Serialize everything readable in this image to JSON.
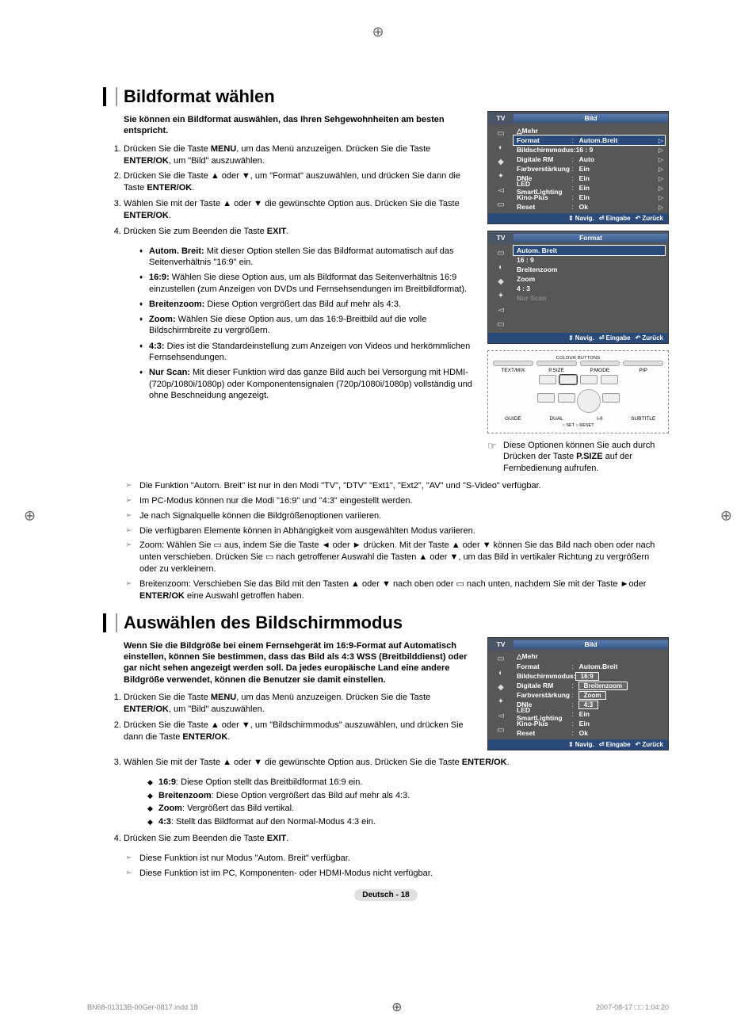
{
  "registration_mark": "⊕",
  "footer": {
    "left": "BN68-01313B-00Ger-0817.indd   18",
    "right": "2007-08-17   □□ 1:04:20"
  },
  "page_number": "Deutsch - 18",
  "section1": {
    "title": "Bildformat wählen",
    "intro": "Sie können ein Bildformat auswählen, das Ihren Sehgewohnheiten am besten entspricht.",
    "steps": [
      "Drücken Sie die Taste <b>MENU</b>, um das Menü anzuzeigen. Drücken Sie die Taste <b>ENTER/OK</b>, um \"Bild\" auszuwählen.",
      "Drücken Sie die Taste ▲ oder ▼, um \"Format\" auszuwählen, und drücken Sie dann die Taste <b>ENTER/OK</b>.",
      "Wählen Sie mit der Taste ▲ oder ▼ die gewünschte Option aus. Drücken Sie die Taste <b>ENTER/OK</b>.",
      "Drücken Sie zum Beenden die Taste <b>EXIT</b>."
    ],
    "bullets": [
      {
        "term": "Autom. Breit:",
        "desc": " Mit dieser Option stellen Sie das Bildformat automatisch auf das Seitenverhältnis \"16:9\" ein."
      },
      {
        "term": "16:9:",
        "desc": " Wählen Sie diese Option aus, um als Bildformat das Seitenverhältnis 16:9 einzustellen (zum Anzeigen von DVDs und Fernsehsendungen im Breitbildformat)."
      },
      {
        "term": "Breitenzoom:",
        "desc": " Diese Option vergrößert das Bild auf mehr als 4:3."
      },
      {
        "term": "Zoom:",
        "desc": " Wählen Sie diese Option aus, um das 16:9-Breitbild auf die volle Bildschirmbreite zu vergrößern."
      },
      {
        "term": "4:3:",
        "desc": " Dies ist die Standardeinstellung zum Anzeigen von Videos und herkömmlichen Fernsehsendungen."
      },
      {
        "term": "Nur Scan:",
        "desc": " Mit dieser Funktion wird das ganze Bild auch bei Versorgung mit HDMI- (720p/1080i/1080p) oder Komponentensignalen (720p/1080i/1080p) vollständig und ohne Beschneidung angezeigt."
      }
    ],
    "notes": [
      "Die Funktion \"Autom. Breit\" ist nur in den Modi \"TV\", \"DTV\" \"Ext1\", \"Ext2\", \"AV\" und \"S-Video\" verfügbar.",
      "Im PC-Modus können nur die Modi \"16:9\" und \"4:3\" eingestellt werden.",
      "Je nach Signalquelle können die Bildgrößenoptionen variieren.",
      "Die verfügbaren Elemente können in Abhängigkeit vom ausgewählten Modus variieren.",
      "Zoom: Wählen Sie ▭ aus, indem Sie die Taste ◄ oder ► drücken. Mit der Taste ▲ oder ▼ können Sie das Bild nach oben oder nach unten verschieben. Drücken Sie ▭ nach getroffener Auswahl die Tasten ▲ oder ▼, um das Bild in vertikaler Richtung zu vergrößern oder zu verkleinern.",
      "Breitenzoom: Verschieben Sie das Bild mit den Tasten ▲ oder ▼ nach oben oder ▭ nach unten, nachdem Sie mit der Taste ►oder <b>ENTER/OK</b> eine Auswahl getroffen haben."
    ],
    "hand_note": "Diese Optionen können Sie auch durch Drücken der Taste <b>P.SIZE</b> auf der Fernbedienung aufrufen.",
    "osd1": {
      "tv": "TV",
      "title": "Bild",
      "more": "△Mehr",
      "items": [
        {
          "label": "Format",
          "val": "Autom.Breit",
          "hi": true
        },
        {
          "label": "Bildschirmmodus:",
          "val": "16 : 9"
        },
        {
          "label": "Digitale RM",
          "val": "Auto"
        },
        {
          "label": "Farbverstärkung",
          "val": "Ein"
        },
        {
          "label": "DNIe",
          "val": "Ein"
        },
        {
          "label": "LED SmartLighting",
          "val": "Ein"
        },
        {
          "label": "Kino-Plus",
          "val": "Ein"
        },
        {
          "label": "Reset",
          "val": "Ok"
        }
      ],
      "footer": {
        "nav": "Navig.",
        "enter": "Eingabe",
        "back": "Zurück"
      }
    },
    "osd2": {
      "tv": "TV",
      "title": "Format",
      "items": [
        {
          "label": "Autom. Breit",
          "hi": true
        },
        {
          "label": "16 : 9"
        },
        {
          "label": "Breitenzoom"
        },
        {
          "label": "Zoom"
        },
        {
          "label": "4 : 3"
        },
        {
          "label": "Nur Scan",
          "dim": true
        }
      ],
      "footer": {
        "nav": "Navig.",
        "enter": "Eingabe",
        "back": "Zurück"
      }
    },
    "remote": {
      "row1": [
        "TEXT/MIX",
        "P.SIZE",
        "P.MODE",
        "PIP"
      ],
      "row2": [
        "GUIDE",
        "DUAL",
        "I-II",
        "SUBTITLE"
      ],
      "top_label": "COLOUR BUTTONS",
      "bottom": "○ SET    ○ RESET"
    }
  },
  "section2": {
    "title": "Auswählen des Bildschirmmodus",
    "intro": "Wenn Sie die Bildgröße bei einem Fernsehgerät im 16:9-Format auf Automatisch einstellen, können Sie bestimmen, dass das Bild als 4:3 WSS (Breitbilddienst) oder gar nicht sehen angezeigt werden soll. Da jedes europäische Land eine andere Bildgröße verwendet, können die Benutzer sie damit einstellen.",
    "steps": [
      "Drücken Sie die Taste <b>MENU</b>, um das Menü anzuzeigen. Drücken Sie die Taste <b>ENTER/OK</b>, um \"Bild\" auszuwählen.",
      "Drücken Sie die Taste ▲ oder ▼, um \"Bildschirmmodus\" auszuwählen, und drücken Sie dann die Taste <b>ENTER/OK</b>.",
      "Wählen Sie mit der Taste ▲ oder ▼ die gewünschte Option aus. Drücken Sie die Taste <b>ENTER/OK</b>."
    ],
    "diamonds": [
      "<b>16:9</b>: Diese Option stellt das Breitbildformat 16:9 ein.",
      "<b>Breitenzoom</b>: Diese Option vergrößert das Bild auf mehr als 4:3.",
      "<b>Zoom</b>: Vergrößert das Bild vertikal.",
      "<b>4:3</b>: Stellt das Bildformat auf den Normal-Modus 4:3 ein."
    ],
    "step4": "Drücken Sie zum Beenden die Taste <b>EXIT</b>.",
    "notes": [
      "Diese Funktion ist nur Modus \"Autom. Breit\" verfügbar.",
      "Diese Funktion ist im PC, Komponenten- oder HDMI-Modus nicht verfügbar."
    ],
    "osd": {
      "tv": "TV",
      "title": "Bild",
      "more": "△Mehr",
      "items": [
        {
          "label": "Format",
          "val": "Autom.Breit"
        },
        {
          "label": "Bildschirmmodus:",
          "val": "16:9",
          "drop": true,
          "hi": true
        },
        {
          "label": "Digitale RM",
          "val": "Breitenzoom",
          "drop": true
        },
        {
          "label": "Farbverstärkung",
          "val": "Zoom",
          "drop": true
        },
        {
          "label": "DNIe",
          "val": "4:3",
          "drop": true
        },
        {
          "label": "LED SmartLighting",
          "val": "Ein"
        },
        {
          "label": "Kino-Plus",
          "val": "Ein"
        },
        {
          "label": "Reset",
          "val": "Ok"
        }
      ],
      "footer": {
        "nav": "Navig.",
        "enter": "Eingabe",
        "back": "Zurück"
      }
    }
  }
}
